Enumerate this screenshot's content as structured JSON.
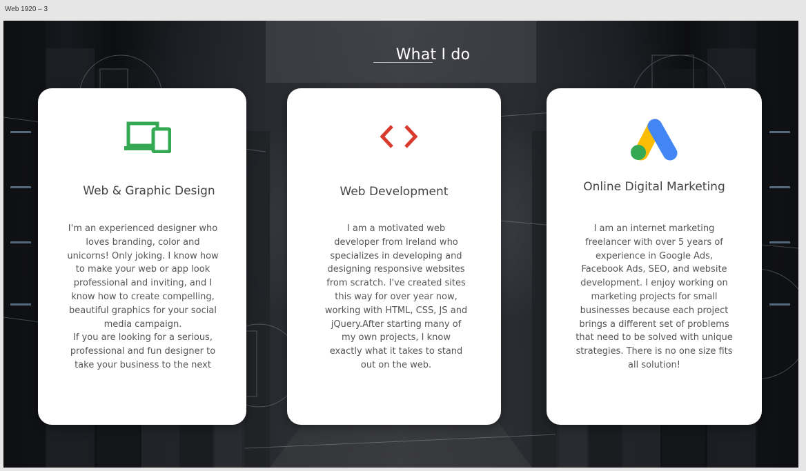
{
  "frame_label": "Web 1920 – 3",
  "section": {
    "title": "What I do"
  },
  "cards": [
    {
      "icon": "devices-icon",
      "icon_color": "#34a853",
      "title": "Web & Graphic Design",
      "body": "I'm an experienced designer who\nloves branding, color and\nunicorns! Only joking. I know how\nto make your web or app  look\nprofessional and inviting, and I\nknow how to create compelling,\nbeautiful graphics for your social\nmedia campaign.\nIf you are looking for a serious,\nprofessional and fun designer to\ntake your business to the next"
    },
    {
      "icon": "code-icon",
      "icon_color": "#d93a2e",
      "title": "Web Development",
      "body": "I am a motivated web\ndeveloper from Ireland who\nspecializes in developing and\ndesigning responsive websites\nfrom scratch. I've created sites\nthis way for over  year now,\nworking with HTML, CSS, JS and\njQuery.After starting many of\nmy own projects, I know\nexactly what it takes to stand\nout on the web."
    },
    {
      "icon": "google-ads-icon",
      "icon_colors": [
        "#fbbc04",
        "#4285f4",
        "#34a853"
      ],
      "title": "Online Digital Marketing",
      "body": "I am an internet marketing\nfreelancer with over 5 years of\nexperience in Google Ads,\nFacebook Ads, SEO, and website\ndevelopment. I enjoy working on\nmarketing projects for small\nbusinesses because each project\nbrings a different set of problems\nthat need to be solved with unique\nstrategies. There is no one size fits\nall solution!"
    }
  ]
}
